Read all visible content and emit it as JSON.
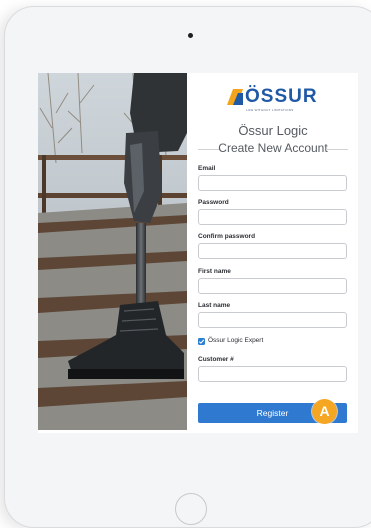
{
  "brand": {
    "name": "ÖSSUR",
    "tagline": "LIFE WITHOUT LIMITATIONS",
    "color": "#1f59a6",
    "accent": "#f2a51a"
  },
  "app_title": "Össur Logic",
  "form_title": "Create New Account",
  "fields": [
    {
      "label": "Email",
      "value": ""
    },
    {
      "label": "Password",
      "value": ""
    },
    {
      "label": "Confirm password",
      "value": ""
    },
    {
      "label": "First name",
      "value": ""
    },
    {
      "label": "Last name",
      "value": ""
    }
  ],
  "checkbox": {
    "label": "Össur Logic Expert",
    "checked": true
  },
  "customer_field": {
    "label": "Customer #",
    "value": ""
  },
  "register_button": {
    "label": "Register",
    "color": "#2f7ad0"
  },
  "callout_badge": {
    "label": "A",
    "color": "#f5a623"
  },
  "photo": {
    "subject": "prosthetic leg with black boot on stairs"
  }
}
